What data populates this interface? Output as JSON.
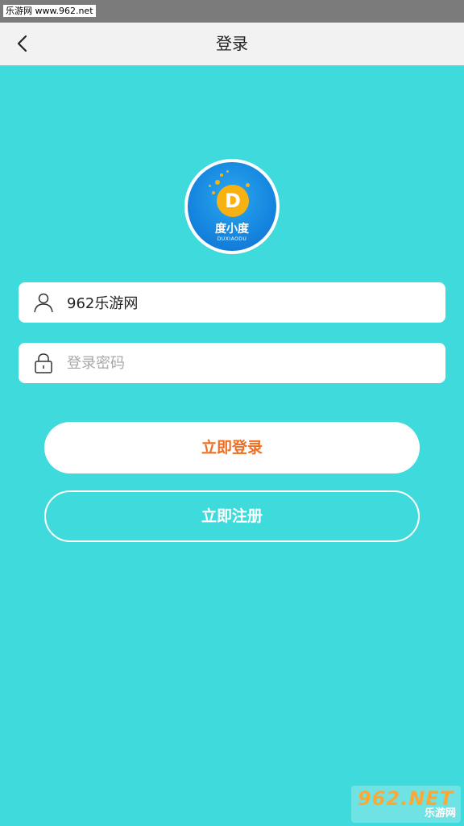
{
  "status_bar": {
    "watermark": "乐游网 www.962.net"
  },
  "nav": {
    "title": "登录"
  },
  "logo": {
    "letter": "D",
    "name": "度小度",
    "subtitle": "DUXIAODU"
  },
  "form": {
    "username_value": "962乐游网",
    "password_placeholder": "登录密码"
  },
  "buttons": {
    "login": "立即登录",
    "register": "立即注册"
  },
  "watermark": {
    "main": "962.NET",
    "sub": "乐游网"
  },
  "colors": {
    "background": "#3fdadb",
    "login_text": "#ef6e22",
    "logo_blue": "#1585df",
    "logo_orange": "#f8b112"
  }
}
